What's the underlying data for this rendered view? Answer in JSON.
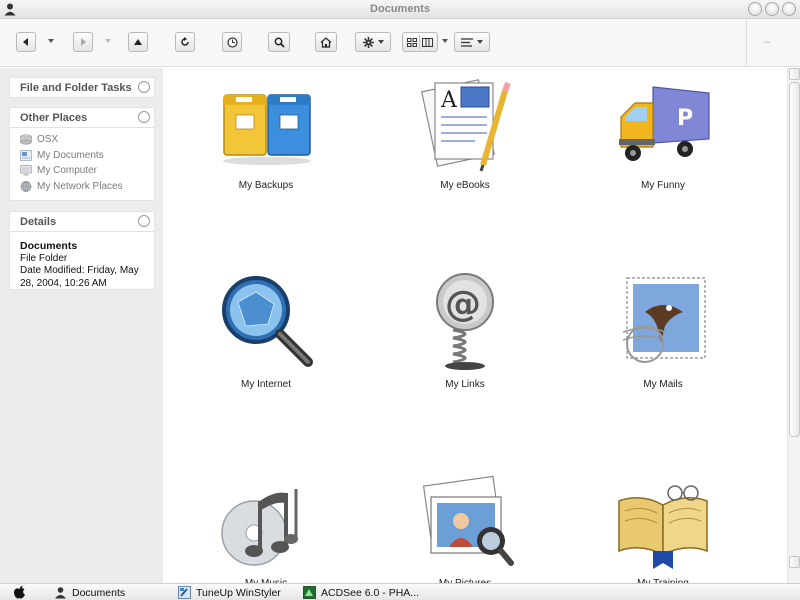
{
  "window": {
    "title": "Documents"
  },
  "toolbar": {
    "back_icon": "back-arrow-icon",
    "forward_icon": "forward-arrow-icon",
    "right_indicator": "~"
  },
  "sidebar": {
    "tasks_header": "File and Folder Tasks",
    "places_header": "Other Places",
    "places": [
      {
        "label": "OSX",
        "icon": "drive-icon"
      },
      {
        "label": "My Documents",
        "icon": "documents-folder-icon"
      },
      {
        "label": "My Computer",
        "icon": "computer-icon"
      },
      {
        "label": "My Network Places",
        "icon": "network-icon"
      }
    ],
    "details_header": "Details",
    "details": {
      "name": "Documents",
      "type": "File Folder",
      "date_modified": "Date Modified: Friday, May 28, 2004, 10:26 AM"
    }
  },
  "folders": [
    {
      "label": "My Backups",
      "icon": "mailboxes-icon"
    },
    {
      "label": "My eBooks",
      "icon": "textedit-icon"
    },
    {
      "label": "My Funny",
      "icon": "delivery-truck-icon"
    },
    {
      "label": "My Internet",
      "icon": "magnifier-globe-icon"
    },
    {
      "label": "My Links",
      "icon": "at-spring-icon"
    },
    {
      "label": "My Mails",
      "icon": "stamp-eagle-icon"
    },
    {
      "label": "My Music",
      "icon": "music-notes-icon"
    },
    {
      "label": "My Pictures",
      "icon": "photos-icon"
    },
    {
      "label": "My Training",
      "icon": "open-book-icon"
    }
  ],
  "taskbar": {
    "items": [
      {
        "label": "Documents"
      },
      {
        "label": "TuneUp WinStyler"
      },
      {
        "label": "ACDSee 6.0 - PHA..."
      }
    ]
  },
  "colors": {
    "sidebar_bg": "#ececec",
    "toolbar_bg": "#f7f7f7",
    "content_bg": "#ffffff",
    "title_text": "#8a8a8a"
  }
}
